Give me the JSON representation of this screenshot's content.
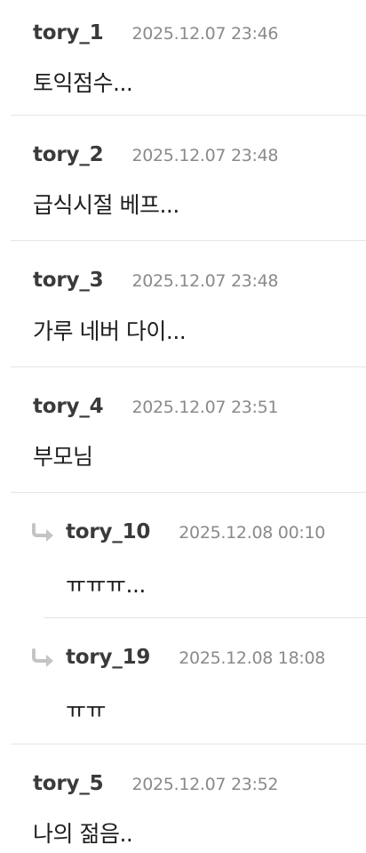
{
  "comments": [
    {
      "author": "tory_1",
      "time": "2025.12.07 23:46",
      "text": "토익점수..."
    },
    {
      "author": "tory_2",
      "time": "2025.12.07 23:48",
      "text": "급식시절 베프..."
    },
    {
      "author": "tory_3",
      "time": "2025.12.07 23:48",
      "text": "가루 네버 다이..."
    },
    {
      "author": "tory_4",
      "time": "2025.12.07 23:51",
      "text": "부모님"
    },
    {
      "author": "tory_10",
      "time": "2025.12.08 00:10",
      "text": "ㅠㅠㅠ...",
      "reply": true
    },
    {
      "author": "tory_19",
      "time": "2025.12.08 18:08",
      "text": "ㅠㅠ",
      "reply": true
    },
    {
      "author": "tory_5",
      "time": "2025.12.07 23:52",
      "text": "나의 젊음.."
    }
  ],
  "colors": {
    "author": "#3a3a3a",
    "timestamp": "#8a8a8a",
    "divider": "#e6e6e6",
    "reply_icon": "#c4c4c4"
  },
  "icons": {
    "reply": "reply-arrow-icon"
  }
}
